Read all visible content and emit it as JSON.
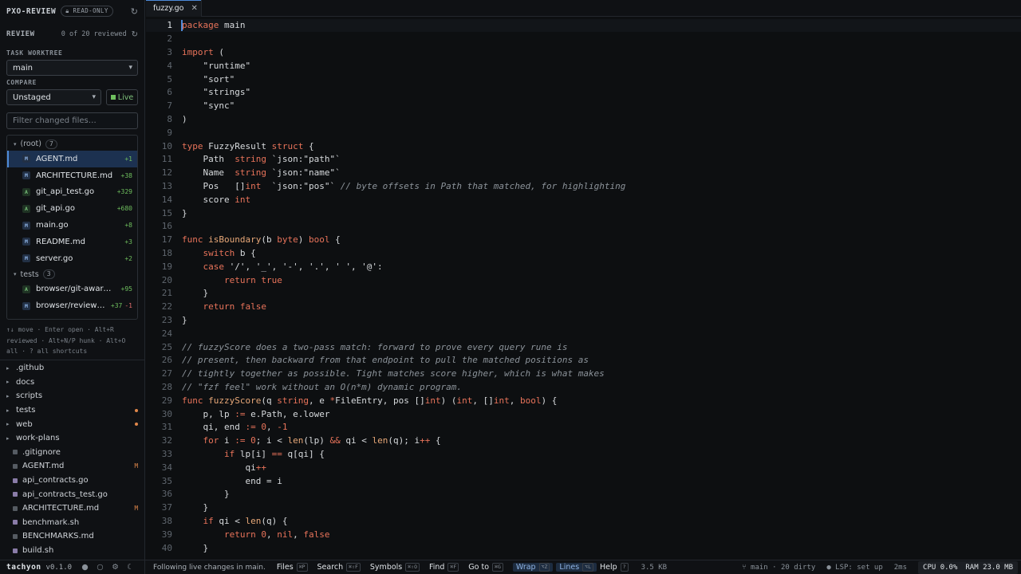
{
  "sidebar": {
    "brand": "PXO-REVIEW",
    "readonly_badge": "READ-ONLY",
    "review_label": "REVIEW",
    "review_count": "0 of 20 reviewed",
    "task_worktree_label": "TASK WORKTREE",
    "worktree_value": "main",
    "compare_label": "COMPARE",
    "compare_value": "Unstaged",
    "live_label": "Live",
    "filter_placeholder": "Filter changed files…",
    "groups": [
      {
        "name": "(root)",
        "count": "7",
        "files": [
          {
            "status": "M",
            "name": "AGENT.md",
            "added": "+1",
            "removed": ""
          },
          {
            "status": "M",
            "name": "ARCHITECTURE.md",
            "added": "+38",
            "removed": ""
          },
          {
            "status": "A",
            "name": "git_api_test.go",
            "added": "+329",
            "removed": ""
          },
          {
            "status": "A",
            "name": "git_api.go",
            "added": "+680",
            "removed": ""
          },
          {
            "status": "M",
            "name": "main.go",
            "added": "+8",
            "removed": ""
          },
          {
            "status": "M",
            "name": "README.md",
            "added": "+3",
            "removed": ""
          },
          {
            "status": "M",
            "name": "server.go",
            "added": "+2",
            "removed": ""
          }
        ]
      },
      {
        "name": "tests",
        "count": "3",
        "files": [
          {
            "status": "A",
            "name": "browser/git-aware-review.spec.ts",
            "added": "+95",
            "removed": ""
          },
          {
            "status": "M",
            "name": "browser/review-mode.spec.ts",
            "added": "+37",
            "removed": "-1"
          }
        ]
      }
    ],
    "hint": "↑↓ move · Enter open · Alt+R reviewed · Alt+N/P hunk · Alt+O all · ? all shortcuts",
    "tree": [
      {
        "kind": "dir",
        "name": ".github",
        "mark": ""
      },
      {
        "kind": "dir",
        "name": "docs",
        "mark": ""
      },
      {
        "kind": "dir",
        "name": "scripts",
        "mark": ""
      },
      {
        "kind": "dir",
        "name": "tests",
        "mark": "dot"
      },
      {
        "kind": "dir",
        "name": "web",
        "mark": "dot"
      },
      {
        "kind": "dir",
        "name": "work-plans",
        "mark": ""
      },
      {
        "kind": "file",
        "name": ".gitignore",
        "mark": "",
        "color": "grey"
      },
      {
        "kind": "file",
        "name": "AGENT.md",
        "mark": "M",
        "color": "grey"
      },
      {
        "kind": "file",
        "name": "api_contracts.go",
        "mark": "",
        "color": "purple"
      },
      {
        "kind": "file",
        "name": "api_contracts_test.go",
        "mark": "",
        "color": "purple"
      },
      {
        "kind": "file",
        "name": "ARCHITECTURE.md",
        "mark": "M",
        "color": "grey"
      },
      {
        "kind": "file",
        "name": "benchmark.sh",
        "mark": "",
        "color": "purple"
      },
      {
        "kind": "file",
        "name": "BENCHMARKS.md",
        "mark": "",
        "color": "grey"
      },
      {
        "kind": "file",
        "name": "build.sh",
        "mark": "",
        "color": "purple"
      }
    ]
  },
  "editor": {
    "tab_name": "fuzzy.go",
    "current_line": 1,
    "lines": [
      "<span class=\"k\">package</span> main",
      "",
      "<span class=\"k\">import</span> (",
      "    <span class=\"s\">\"runtime\"</span>",
      "    <span class=\"s\">\"sort\"</span>",
      "    <span class=\"s\">\"strings\"</span>",
      "    <span class=\"s\">\"sync\"</span>",
      ")",
      "",
      "<span class=\"k\">type</span> FuzzyResult <span class=\"k\">struct</span> {",
      "    Path  <span class=\"t\">string</span> `json:\"path\"`",
      "    Name  <span class=\"t\">string</span> `json:\"name\"`",
      "    Pos   []<span class=\"t\">int</span>  `json:\"pos\"` <span class=\"c\">// byte offsets in Path that matched, for highlighting</span>",
      "    score <span class=\"t\">int</span>",
      "}",
      "",
      "<span class=\"k\">func</span> <span class=\"f\">isBoundary</span>(b <span class=\"t\">byte</span>) <span class=\"t\">bool</span> {",
      "    <span class=\"k\">switch</span> b {",
      "    <span class=\"k\">case</span> '/', '_', '-', '.', ' ', '@':",
      "        <span class=\"k\">return</span> <span class=\"k\">true</span>",
      "    }",
      "    <span class=\"k\">return</span> <span class=\"k\">false</span>",
      "}",
      "",
      "<span class=\"c\">// fuzzyScore does a two-pass match: forward to prove every query rune is</span>",
      "<span class=\"c\">// present, then backward from that endpoint to pull the matched positions as</span>",
      "<span class=\"c\">// tightly together as possible. Tight matches score higher, which is what makes</span>",
      "<span class=\"c\">// \"fzf feel\" work without an O(n*m) dynamic program.</span>",
      "<span class=\"k\">func</span> <span class=\"f\">fuzzyScore</span>(q <span class=\"t\">string</span>, e <span class=\"k\">*</span>FileEntry, pos []<span class=\"t\">int</span>) (<span class=\"t\">int</span>, []<span class=\"t\">int</span>, <span class=\"t\">bool</span>) {",
      "    p, lp <span class=\"k\">:=</span> e.Path, e.lower",
      "    qi, end <span class=\"k\">:=</span> <span class=\"t\">0</span>, <span class=\"t\">-1</span>",
      "    <span class=\"k\">for</span> i <span class=\"k\">:=</span> <span class=\"t\">0</span>; i &lt; <span class=\"f\">len</span>(lp) <span class=\"k\">&amp;&amp;</span> qi &lt; <span class=\"f\">len</span>(q); i<span class=\"k\">++</span> {",
      "        <span class=\"k\">if</span> lp[i] <span class=\"k\">==</span> q[qi] {",
      "            qi<span class=\"k\">++</span>",
      "            end = i",
      "        }",
      "    }",
      "    <span class=\"k\">if</span> qi &lt; <span class=\"f\">len</span>(q) {",
      "        <span class=\"k\">return</span> <span class=\"t\">0</span>, <span class=\"k\">nil</span>, <span class=\"k\">false</span>",
      "    }"
    ]
  },
  "status": {
    "brand": "tachyon",
    "version": "v0.1.0",
    "message": "Following live changes in main.",
    "items": [
      {
        "label": "Files",
        "kbd": "⌘P",
        "active": false
      },
      {
        "label": "Search",
        "kbd": "⌘⇧F",
        "active": false
      },
      {
        "label": "Symbols",
        "kbd": "⌘⇧O",
        "active": false
      },
      {
        "label": "Find",
        "kbd": "⌘F",
        "active": false
      },
      {
        "label": "Go to",
        "kbd": "⌘G",
        "active": false
      },
      {
        "label": "Wrap",
        "kbd": "⌥Z",
        "active": true
      },
      {
        "label": "Lines",
        "kbd": "⌥L",
        "active": true
      },
      {
        "label": "Help",
        "kbd": "?",
        "active": false
      }
    ],
    "file_size": "3.5 KB",
    "branch": "main · 20 dirty",
    "lsp": "LSP: set up",
    "latency": "2ms",
    "cpu": "CPU 0.0%",
    "ram": "RAM 23.0 MB"
  },
  "colors": {
    "accent": "#4d8ad8",
    "added": "#6fbf5e",
    "removed": "#e06c6c",
    "keyword": "#e8735a",
    "modified": "#e0874a"
  }
}
